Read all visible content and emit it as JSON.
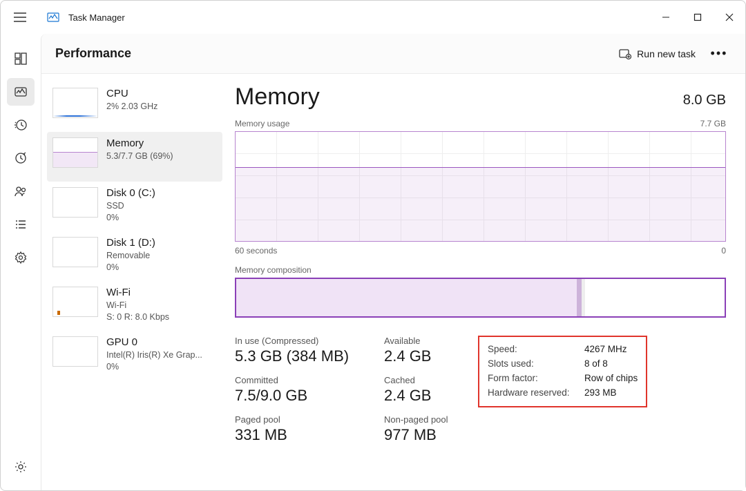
{
  "window": {
    "title": "Task Manager"
  },
  "header": {
    "page_title": "Performance",
    "run_task_label": "Run new task"
  },
  "sidebar": {
    "items": [
      {
        "label": "CPU",
        "sub": "2%  2.03 GHz",
        "thumb": "cpu"
      },
      {
        "label": "Memory",
        "sub": "5.3/7.7 GB (69%)",
        "thumb": "memory"
      },
      {
        "label": "Disk 0 (C:)",
        "sub": "SSD\n0%",
        "thumb": "blank"
      },
      {
        "label": "Disk 1 (D:)",
        "sub": "Removable\n0%",
        "thumb": "blank"
      },
      {
        "label": "Wi-Fi",
        "sub": "Wi-Fi\nS: 0  R: 8.0 Kbps",
        "thumb": "wifi"
      },
      {
        "label": "GPU 0",
        "sub": "Intel(R) Iris(R) Xe Grap...\n0%",
        "thumb": "blank"
      }
    ],
    "active_index": 1
  },
  "detail": {
    "title": "Memory",
    "capacity": "8.0 GB",
    "usage_label": "Memory usage",
    "usage_max": "7.7 GB",
    "axis_left": "60 seconds",
    "axis_right": "0",
    "composition_label": "Memory composition",
    "stats": {
      "inuse_label": "In use (Compressed)",
      "inuse_value": "5.3 GB (384 MB)",
      "available_label": "Available",
      "available_value": "2.4 GB",
      "committed_label": "Committed",
      "committed_value": "7.5/9.0 GB",
      "cached_label": "Cached",
      "cached_value": "2.4 GB",
      "paged_label": "Paged pool",
      "paged_value": "331 MB",
      "nonpaged_label": "Non-paged pool",
      "nonpaged_value": "977 MB"
    },
    "info": {
      "speed_k": "Speed:",
      "speed_v": "4267 MHz",
      "slots_k": "Slots used:",
      "slots_v": "8 of 8",
      "form_k": "Form factor:",
      "form_v": "Row of chips",
      "reserved_k": "Hardware reserved:",
      "reserved_v": "293 MB"
    }
  }
}
